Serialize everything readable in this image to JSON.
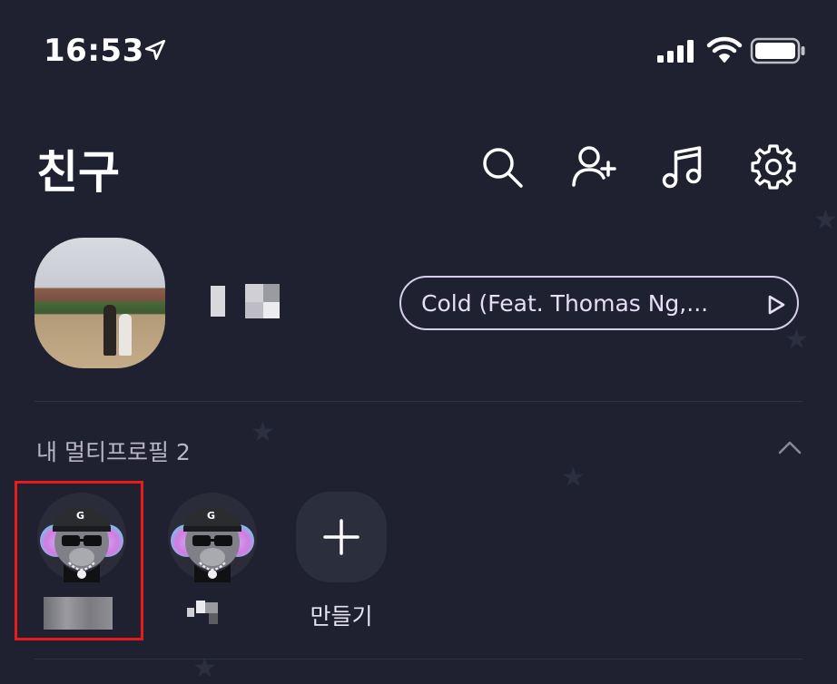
{
  "status_bar": {
    "time": "16:53"
  },
  "header": {
    "title": "친구"
  },
  "my_profile": {
    "now_playing": "Cold (Feat. Thomas Ng,..."
  },
  "multi_profile": {
    "section_title": "내 멀티프로필 2",
    "create_label": "만들기"
  },
  "colors": {
    "background": "#1f2130",
    "pill_border": "#d8ceeb",
    "highlight": "#e51c1c"
  },
  "icons": [
    "location-arrow-icon",
    "signal-icon",
    "wifi-icon",
    "battery-icon",
    "search-icon",
    "add-friend-icon",
    "music-note-icon",
    "gear-icon",
    "play-icon",
    "chevron-up-icon",
    "plus-icon"
  ]
}
